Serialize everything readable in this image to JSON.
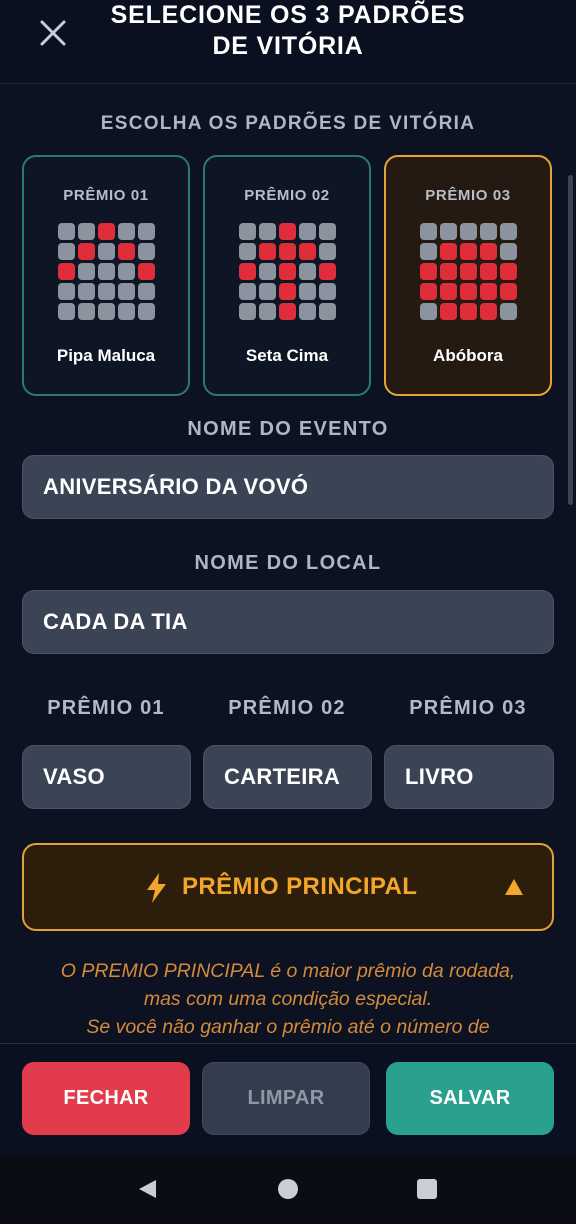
{
  "header": {
    "title_line1": "SELECIONE OS 3 PADRÕES",
    "title_line2": "DE VITÓRIA"
  },
  "patterns_section": {
    "label": "ESCOLHA OS PADRÕES DE VITÓRIA",
    "cards": [
      {
        "label": "PRÊMIO 01",
        "name": "Pipa Maluca",
        "selected": false,
        "grid": [
          [
            0,
            0,
            1,
            0,
            0
          ],
          [
            0,
            1,
            0,
            1,
            0
          ],
          [
            1,
            0,
            0,
            0,
            1
          ],
          [
            0,
            0,
            0,
            0,
            0
          ],
          [
            0,
            0,
            0,
            0,
            0
          ]
        ]
      },
      {
        "label": "PRÊMIO 02",
        "name": "Seta Cima",
        "selected": false,
        "grid": [
          [
            0,
            0,
            1,
            0,
            0
          ],
          [
            0,
            1,
            1,
            1,
            0
          ],
          [
            1,
            0,
            1,
            0,
            1
          ],
          [
            0,
            0,
            1,
            0,
            0
          ],
          [
            0,
            0,
            1,
            0,
            0
          ]
        ]
      },
      {
        "label": "PRÊMIO 03",
        "name": "Abóbora",
        "selected": true,
        "grid": [
          [
            0,
            0,
            0,
            0,
            0
          ],
          [
            0,
            1,
            1,
            1,
            0
          ],
          [
            1,
            1,
            1,
            1,
            1
          ],
          [
            1,
            1,
            1,
            1,
            1
          ],
          [
            0,
            1,
            1,
            1,
            0
          ]
        ]
      }
    ]
  },
  "event": {
    "label": "NOME DO EVENTO",
    "value": "ANIVERSÁRIO DA VOVÓ"
  },
  "location": {
    "label": "NOME DO LOCAL",
    "value": "CADA DA TIA"
  },
  "prizes": [
    {
      "label": "PRÊMIO 01",
      "value": "VASO"
    },
    {
      "label": "PRÊMIO 02",
      "value": "CARTEIRA"
    },
    {
      "label": "PRÊMIO 03",
      "value": "LIVRO"
    }
  ],
  "main_prize": {
    "label": "PRÊMIO PRINCIPAL",
    "icon": "lightning-bolt-icon",
    "toggle_icon": "caret-up-icon"
  },
  "info_text": {
    "line1": "O PREMIO PRINCIPAL é o maior prêmio da rodada,",
    "line2": "mas com uma condição especial.",
    "line3": "Se você não ganhar o prêmio até o número de"
  },
  "footer": {
    "close_label": "FECHAR",
    "clear_label": "LIMPAR",
    "save_label": "SALVAR"
  },
  "colors": {
    "background": "#0a1020",
    "card_border": "#2a7a74",
    "selected_border": "#e5a436",
    "cell_on": "#e02d3a",
    "cell_off": "#8b939f",
    "accent_orange": "#f2a72c",
    "close_red": "#e23b4b",
    "save_teal": "#2aa08f"
  }
}
